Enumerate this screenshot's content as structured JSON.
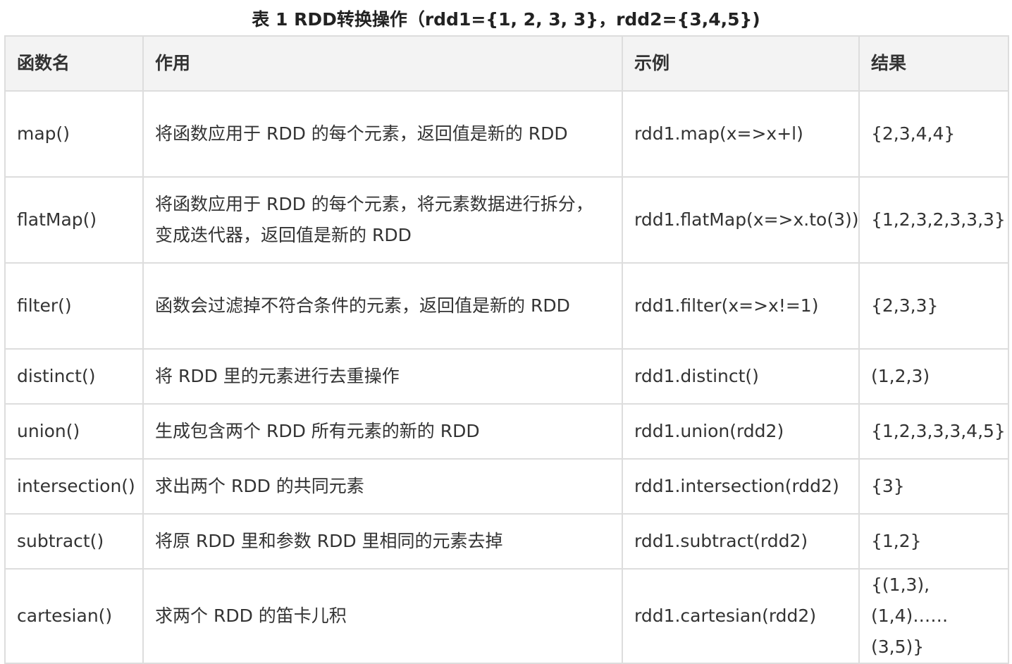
{
  "caption": "表 1 RDD转换操作（rdd1={1, 2, 3, 3}，rdd2={3,4,5})",
  "table": {
    "headers": [
      "函数名",
      "作用",
      "示例",
      "结果"
    ],
    "rows": [
      [
        "map()",
        "将函数应用于 RDD 的每个元素，返回值是新的 RDD",
        "rdd1.map(x=>x+l)",
        "{2,3,4,4}"
      ],
      [
        "flatMap()",
        "将函数应用于 RDD 的每个元素，将元素数据进行拆分，变成迭代器，返回值是新的 RDD",
        "rdd1.flatMap(x=>x.to(3))",
        "{1,2,3,2,3,3,3}"
      ],
      [
        "filter()",
        "函数会过滤掉不符合条件的元素，返回值是新的 RDD",
        "rdd1.filter(x=>x!=1)",
        "{2,3,3}"
      ],
      [
        "distinct()",
        "将 RDD 里的元素进行去重操作",
        "rdd1.distinct()",
        "(1,2,3)"
      ],
      [
        "union()",
        "生成包含两个 RDD 所有元素的新的 RDD",
        "rdd1.union(rdd2)",
        "{1,2,3,3,3,4,5}"
      ],
      [
        "intersection()",
        "求出两个 RDD 的共同元素",
        "rdd1.intersection(rdd2)",
        "{3}"
      ],
      [
        "subtract()",
        "将原 RDD 里和参数 RDD 里相同的元素去掉",
        "rdd1.subtract(rdd2)",
        "{1,2}"
      ],
      [
        "cartesian()",
        "求两个 RDD 的笛卡儿积",
        "rdd1.cartesian(rdd2)",
        "{(1,3),(1,4)……(3,5)}"
      ]
    ]
  }
}
